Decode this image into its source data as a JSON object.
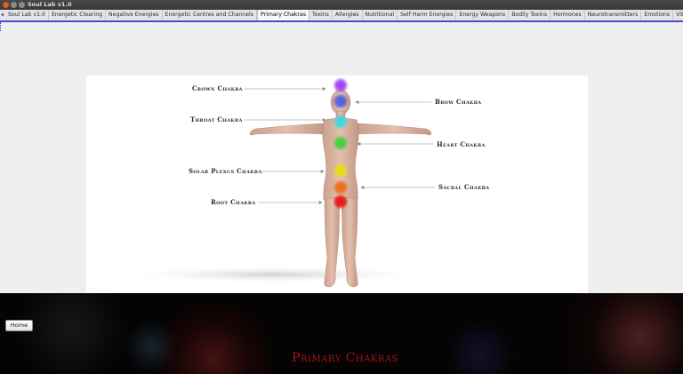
{
  "window": {
    "title": "Soul Lab v1.0"
  },
  "tabs": [
    {
      "label": "Soul Lab v1.0",
      "active": false
    },
    {
      "label": "Energetic Clearing",
      "active": false
    },
    {
      "label": "Negative Energies",
      "active": false
    },
    {
      "label": "Energetic Centres and Channels",
      "active": false
    },
    {
      "label": "Primary Chakras",
      "active": true
    },
    {
      "label": "Toxins",
      "active": false
    },
    {
      "label": "Allergies",
      "active": false
    },
    {
      "label": "Nutritional",
      "active": false
    },
    {
      "label": "Self Harm Energies",
      "active": false
    },
    {
      "label": "Energy Weapons",
      "active": false
    },
    {
      "label": "Bodily Toxins",
      "active": false
    },
    {
      "label": "Hormones",
      "active": false
    },
    {
      "label": "Neurotransmitters",
      "active": false
    },
    {
      "label": "Emotions",
      "active": false
    },
    {
      "label": "Vitamins, Minerals",
      "active": false
    }
  ],
  "chakras": {
    "crown": {
      "label": "Crown Chakra",
      "color": "#9b3cf0"
    },
    "brow": {
      "label": "Brow Chakra",
      "color": "#4b5ce0"
    },
    "throat": {
      "label": "Throat Chakra",
      "color": "#35d8e6"
    },
    "heart": {
      "label": "Heart Chakra",
      "color": "#3ad23a"
    },
    "solar_plexus": {
      "label": "Solar Plexus Chakra",
      "color": "#e8e010"
    },
    "sacral": {
      "label": "Sacral Chakra",
      "color": "#f06a10"
    },
    "root": {
      "label": "Root Chakra",
      "color": "#e81010"
    }
  },
  "home_button": {
    "label": "Home"
  },
  "footer": {
    "title": "Primary Chakras"
  }
}
